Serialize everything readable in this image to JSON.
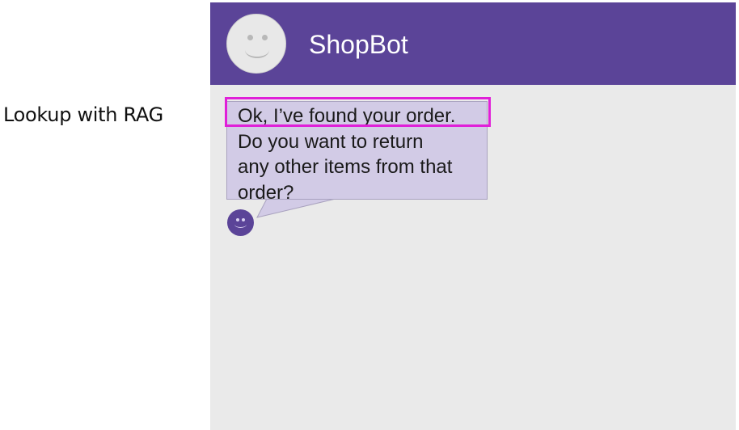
{
  "side_label": "Lookup with RAG",
  "header": {
    "title": "ShopBot",
    "avatar_icon": "smiley-face-icon"
  },
  "message": {
    "line1": "Ok, I’ve found your order.",
    "line2": "Do you want to return",
    "line3": "any other items from that",
    "line4": "order?",
    "sender_icon": "bot-smiley-icon"
  },
  "colors": {
    "header_bg": "#5b4498",
    "chat_bg": "#eaeaea",
    "bubble_bg": "#d2cbe6",
    "highlight": "#e020d8"
  }
}
